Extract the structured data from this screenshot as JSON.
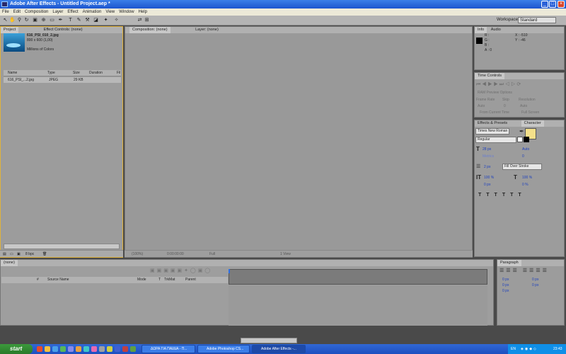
{
  "window": {
    "title": "Adobe After Effects - Untitled Project.aep *",
    "min": "_",
    "max": "□",
    "close": "×"
  },
  "menu": [
    "File",
    "Edit",
    "Composition",
    "Layer",
    "Effect",
    "Animation",
    "View",
    "Window",
    "Help"
  ],
  "toolbar": {
    "workspace_label": "Workspace:",
    "workspace_value": "Standard"
  },
  "project": {
    "tabs": [
      "Project",
      "Effect Controls: (none)"
    ],
    "file_name": "616_PSI_010_2.jpg",
    "file_dims": "800 x 600 (1,00)",
    "file_colors": "Millions of Colors",
    "columns": [
      "Name",
      "Type",
      "Size",
      "Duration",
      "Fil"
    ],
    "rows": [
      {
        "name": "616_PSI_...2.jpg",
        "type": "JPEG",
        "size": "29 KB"
      }
    ],
    "bpc": "8 bpc"
  },
  "comp": {
    "tabs": [
      "Composition: (none)",
      "Layer: (none)"
    ],
    "footer": [
      "(100%)",
      "0:00:00:00",
      "Full",
      "1 View"
    ]
  },
  "info": {
    "tabs": [
      "Info",
      "Audio"
    ],
    "r": "R :",
    "g": "G :",
    "b": "B :",
    "a": "A : 0",
    "x": "X : -510",
    "y": "Y : -46"
  },
  "time_controls": {
    "tab": "Time Controls",
    "ram": "RAM Preview Options",
    "frame_rate": "Frame Rate",
    "skip": "Skip",
    "resolution": "Resolution",
    "auto1": "Auto",
    "zero": "0",
    "auto2": "Auto",
    "from_current": "From Current Time",
    "full_screen": "Full Screen"
  },
  "character": {
    "tabs": [
      "Effects & Presets",
      "Character"
    ],
    "font": "Times New Roman",
    "style": "Regular",
    "size": "28 px",
    "leading": "Auto",
    "kerning": "Metrics",
    "tracking": "0",
    "stroke": "2 px",
    "stroke_type": "Fill Over Stroke",
    "vscale": "100 %",
    "hscale": "100 %",
    "baseline": "0 px",
    "tsume": "0 %"
  },
  "timeline": {
    "tab": "(none)",
    "columns": [
      "#",
      "Source Name",
      "Mode",
      "T",
      "TrkMat",
      "Parent"
    ]
  },
  "paragraph": {
    "tab": "Paragraph",
    "v1": "0 px",
    "v2": "0 px",
    "v3": "0 px",
    "v4": "0 px",
    "v5": "0 px"
  },
  "taskbar": {
    "start": "start",
    "buttons": [
      "ΔΩΡΑ ΓΙΑ ΠΑΙΔΙΑ - Π...",
      "Adobe Photoshop CS...",
      "Adobe After Effects -..."
    ],
    "lang": "EN",
    "clock": "23:43"
  }
}
